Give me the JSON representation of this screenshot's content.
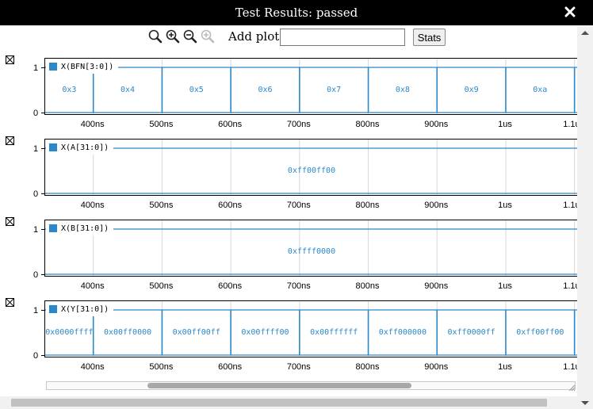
{
  "window": {
    "title": "Test Results: passed",
    "close_icon": "close-icon"
  },
  "toolbar": {
    "icons": [
      "zoom-fit-icon",
      "zoom-in-icon",
      "zoom-out-icon",
      "zoom-reset-icon"
    ],
    "add_plot_label": "Add plot:",
    "add_plot_value": "",
    "stats_label": "Stats"
  },
  "colors": {
    "signal": "#2b88c8",
    "grid": "#d8d8d8"
  },
  "x_ticks": [
    "400ns",
    "500ns",
    "600ns",
    "700ns",
    "800ns",
    "900ns",
    "1us",
    "1.1us"
  ],
  "x_tick_values": [
    400,
    500,
    600,
    700,
    800,
    900,
    1000,
    1100
  ],
  "x_range": [
    330,
    1105
  ],
  "y_ticks": [
    "1",
    "0"
  ],
  "plots": [
    {
      "name": "X(BFN[3:0])",
      "transitions": [
        400,
        500,
        600,
        700,
        800,
        900,
        1000,
        1100
      ],
      "values": [
        "0x3",
        "0x4",
        "0x5",
        "0x6",
        "0x7",
        "0x8",
        "0x9",
        "0xa"
      ]
    },
    {
      "name": "X(A[31:0])",
      "transitions": [],
      "values": [
        "0xff00ff00"
      ]
    },
    {
      "name": "X(B[31:0])",
      "transitions": [],
      "values": [
        "0xffff0000"
      ]
    },
    {
      "name": "X(Y[31:0])",
      "transitions": [
        400,
        500,
        600,
        700,
        800,
        900,
        1000,
        1100
      ],
      "values": [
        "0x0000ffff",
        "0x00ff0000",
        "0x00ff00ff",
        "0x00ffff00",
        "0x00ffffff",
        "0xff000000",
        "0xff0000ff",
        "0xff00ff00"
      ]
    }
  ],
  "scroll": {
    "inner_thumb_start": 0.19,
    "inner_thumb_end": 0.69
  }
}
